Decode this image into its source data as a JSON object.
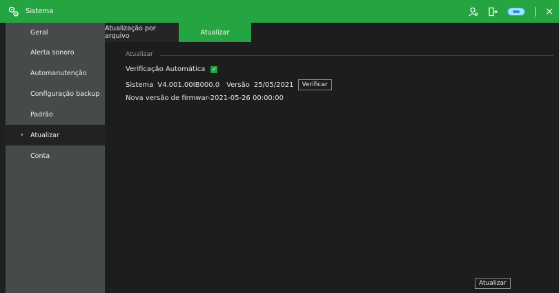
{
  "titlebar": {
    "title": "Sistema",
    "icons": [
      "settings-gears-icon",
      "user-icon",
      "logout-icon",
      "cloud-icon",
      "close-icon"
    ],
    "close_glyph": "×",
    "accent": "#25a442"
  },
  "sidebar": {
    "items": [
      {
        "label": "Geral"
      },
      {
        "label": "Alerta sonoro"
      },
      {
        "label": "Automanutenção"
      },
      {
        "label": "Configuração backup"
      },
      {
        "label": "Padrão"
      },
      {
        "label": "Atualizar",
        "active": true
      },
      {
        "label": "Conta"
      }
    ],
    "active_chevron": "›"
  },
  "tabs": [
    {
      "label": "Atualização por arquivo",
      "active": false
    },
    {
      "label": "Atualizar",
      "active": true
    }
  ],
  "content": {
    "group_label": "Atualizar",
    "auto_check_label": "Verificação Automática",
    "auto_check_checked": true,
    "check_glyph": "✓",
    "system_label": "Sistema",
    "system_value": "V4.001.00IB000.0",
    "version_label": "Versão",
    "version_value": "25/05/2021",
    "verify_button": "Verificar",
    "new_firmware_text": "Nova versão de firmwar-2021-05-26 00:00:00",
    "update_button": "Atualizar"
  }
}
